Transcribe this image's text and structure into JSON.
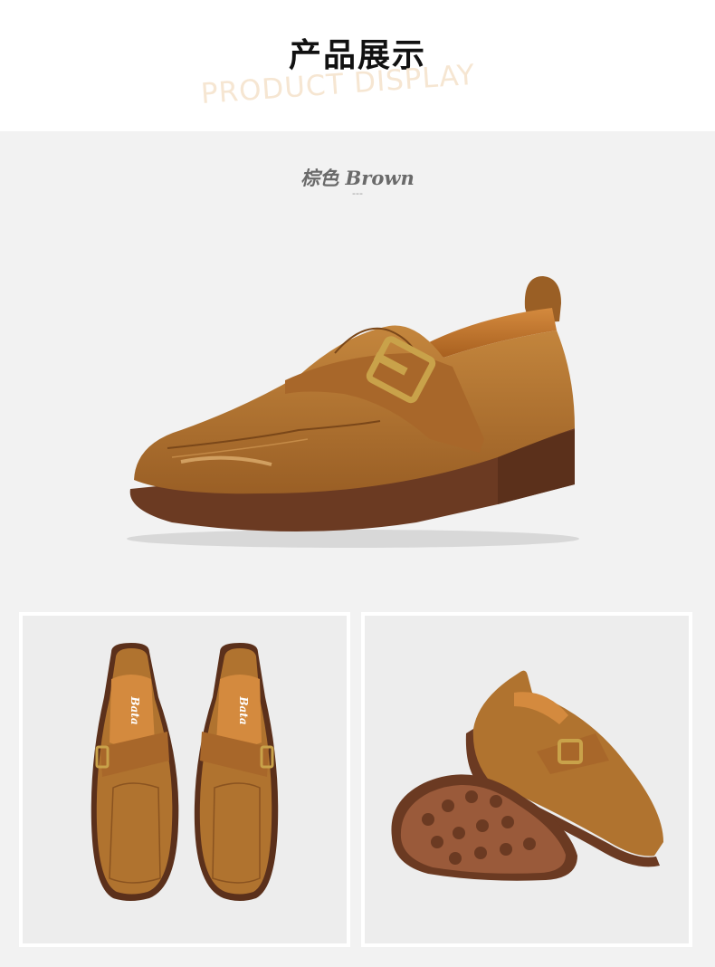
{
  "header": {
    "title_cn": "产品展示",
    "title_en": "PRODUCT DISPLAY"
  },
  "product": {
    "color_label": "棕色 Brown",
    "separator": "---",
    "brand_insole": "Bata"
  },
  "colors": {
    "leather": "#b0732f",
    "leather_dark": "#8a5320",
    "sole": "#6b3a22",
    "buckle": "#c9a24a",
    "background": "#f2f2f2"
  },
  "images": {
    "hero": "monk-strap-shoe-side-view",
    "top": "pair-top-view",
    "angle": "shoe-and-sole-view"
  }
}
